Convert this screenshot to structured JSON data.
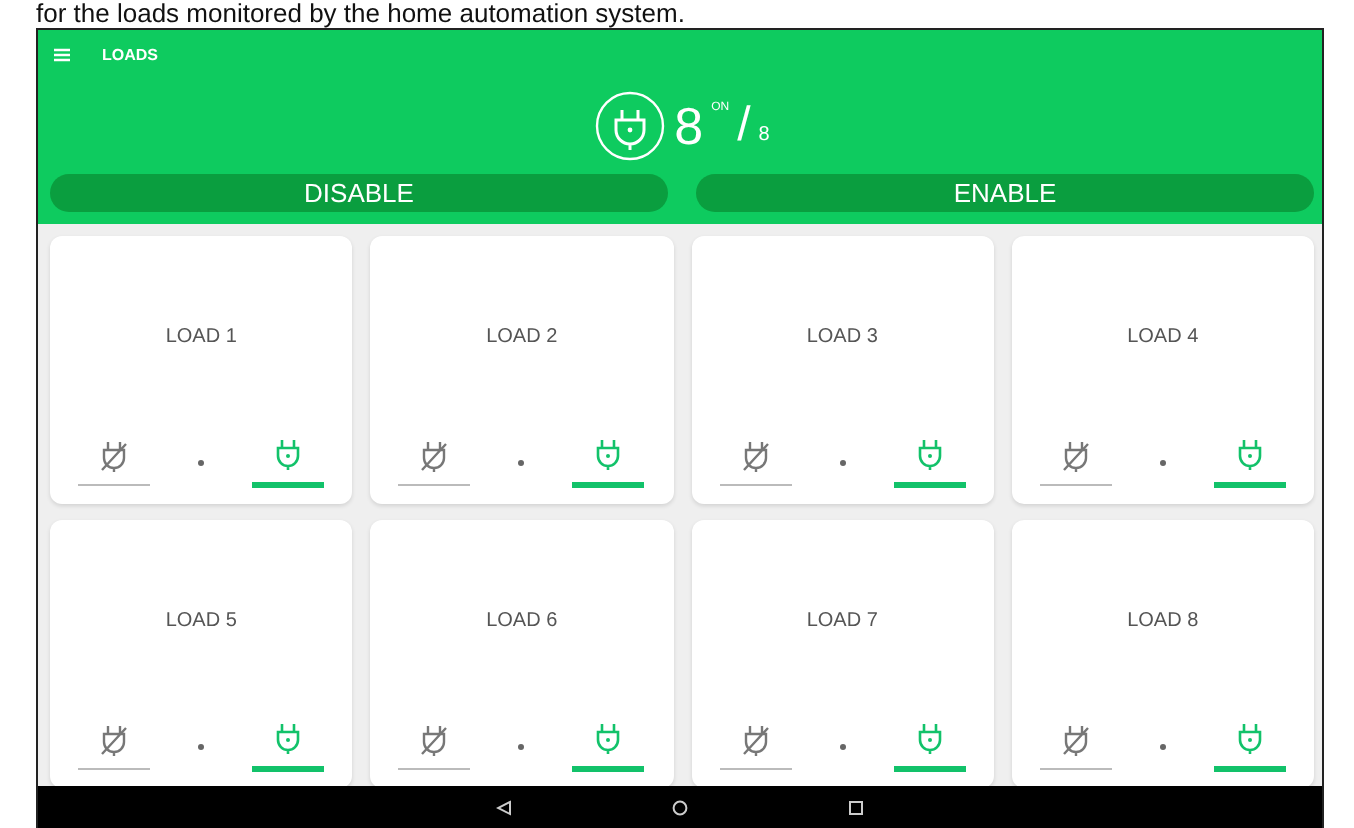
{
  "caption": "for the loads monitored by the home automation system.",
  "app_bar": {
    "title": "LOADS"
  },
  "summary": {
    "count": "8",
    "superscript": "ON",
    "separator": "/",
    "total": "8"
  },
  "actions": [
    "DISABLE",
    "ENABLE"
  ],
  "loads": [
    {
      "name": "LOAD 1",
      "on": true
    },
    {
      "name": "LOAD 2",
      "on": true
    },
    {
      "name": "LOAD 3",
      "on": true
    },
    {
      "name": "LOAD 4",
      "on": true
    },
    {
      "name": "LOAD 5",
      "on": true
    },
    {
      "name": "LOAD 6",
      "on": true
    },
    {
      "name": "LOAD 7",
      "on": true
    },
    {
      "name": "LOAD 8",
      "on": true
    }
  ]
}
